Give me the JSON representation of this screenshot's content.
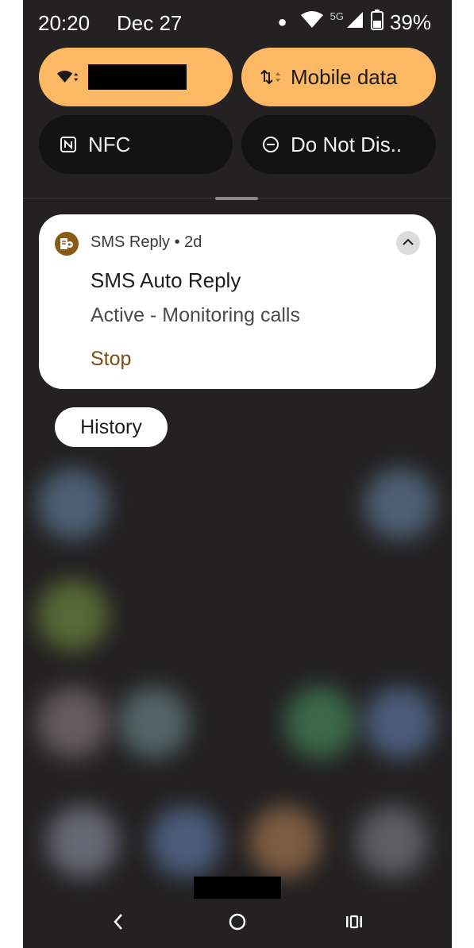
{
  "status_bar": {
    "time": "20:20",
    "date": "Dec 27",
    "network_type": "5G",
    "battery": "39%"
  },
  "quick_settings": {
    "wifi_tile": {
      "label": "",
      "icon": "wifi-icon",
      "state": "on"
    },
    "mobile_data_tile": {
      "label": "Mobile data",
      "icon": "data-arrows-icon",
      "state": "on"
    },
    "nfc_tile": {
      "label": "NFC",
      "icon": "nfc-icon",
      "state": "off"
    },
    "dnd_tile": {
      "label": "Do Not Dis..",
      "icon": "minus-circle-icon",
      "state": "off"
    }
  },
  "notification": {
    "app_name": "SMS Reply",
    "separator": "•",
    "age": "2d",
    "title": "SMS Auto Reply",
    "text": "Active - Monitoring calls",
    "action_label": "Stop",
    "icon": "sms-reply-app-icon"
  },
  "history_button": {
    "label": "History"
  },
  "colors": {
    "tile_on": "#fdb863",
    "tile_off": "#141313",
    "shade_bg": "#232121",
    "action": "#7a4f0f",
    "app_icon_bg": "#8a5a17"
  }
}
